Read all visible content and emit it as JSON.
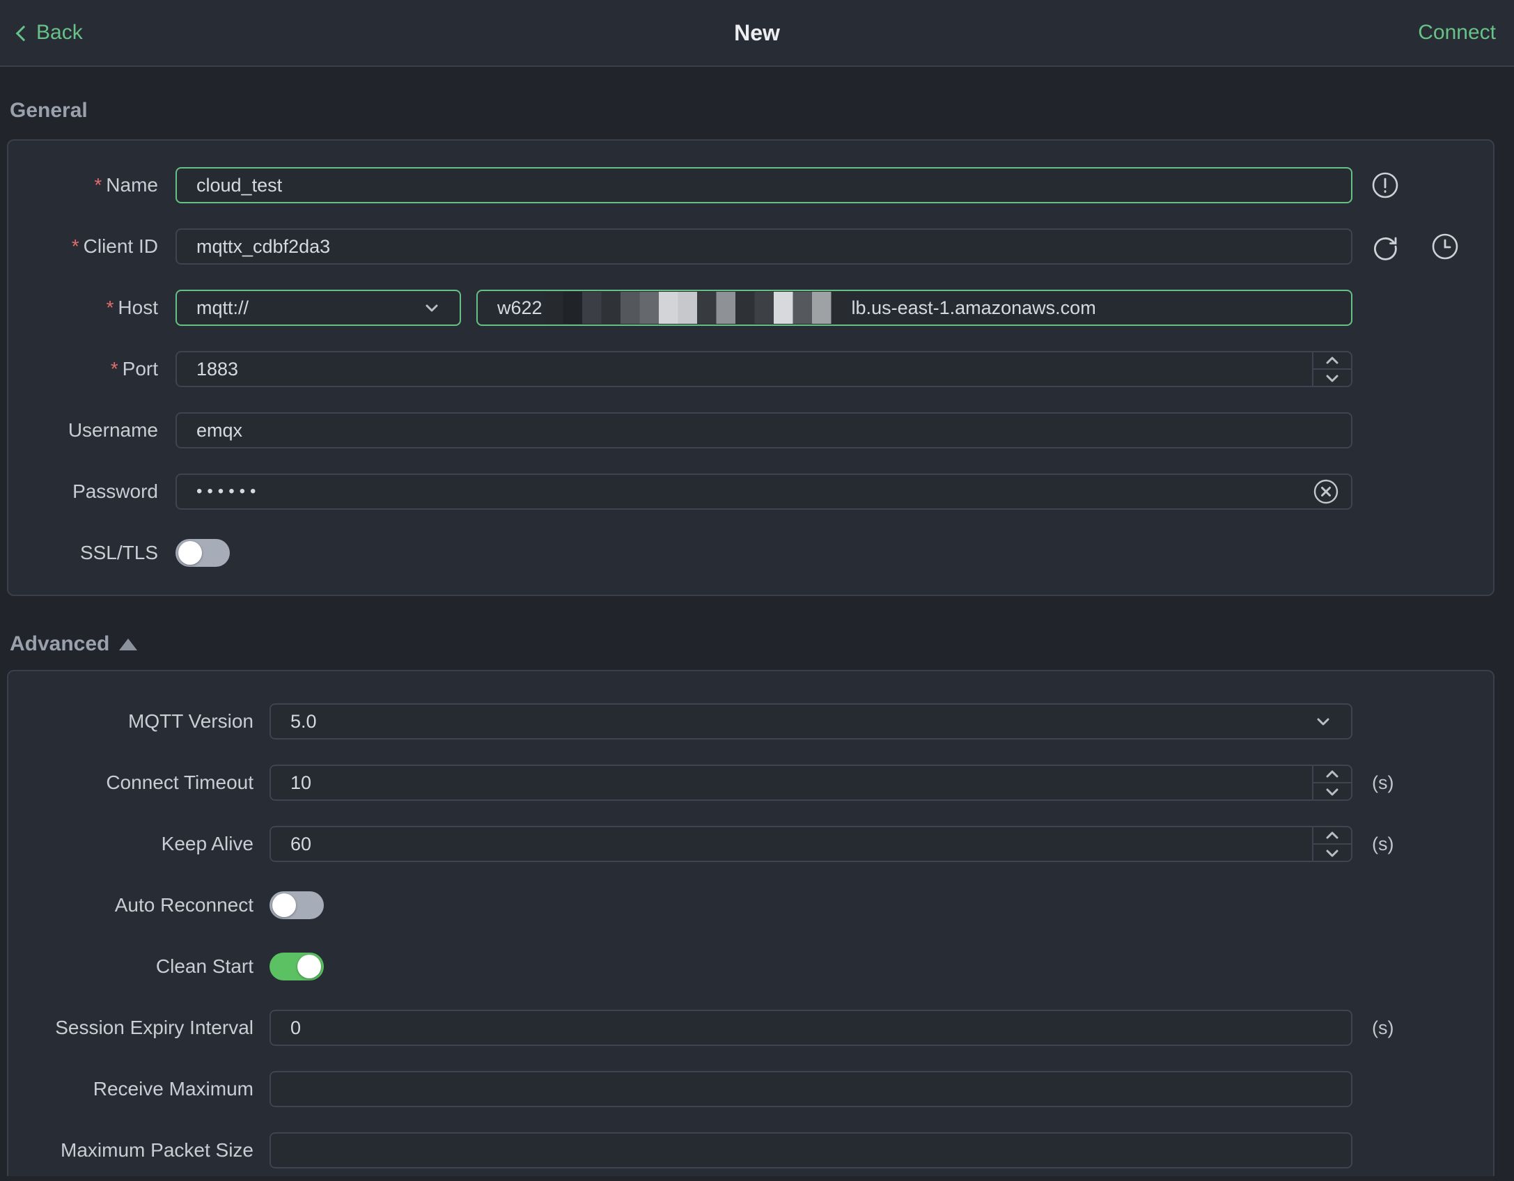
{
  "topbar": {
    "back_label": "Back",
    "title": "New",
    "connect_label": "Connect"
  },
  "required_marker": "*",
  "general": {
    "heading": "General",
    "name": {
      "label": "Name",
      "value": "cloud_test"
    },
    "client_id": {
      "label": "Client ID",
      "value": "mqttx_cdbf2da3"
    },
    "host": {
      "label": "Host",
      "protocol": "mqtt://",
      "visible_prefix": "w622",
      "redacted": true,
      "visible_suffix": "lb.us-east-1.amazonaws.com"
    },
    "port": {
      "label": "Port",
      "value": "1883"
    },
    "username": {
      "label": "Username",
      "value": "emqx"
    },
    "password": {
      "label": "Password",
      "value": "••••••"
    },
    "ssl": {
      "label": "SSL/TLS",
      "enabled": false
    }
  },
  "advanced": {
    "heading": "Advanced",
    "mqtt_version": {
      "label": "MQTT Version",
      "value": "5.0"
    },
    "connect_timeout": {
      "label": "Connect Timeout",
      "value": "10",
      "unit": "(s)"
    },
    "keep_alive": {
      "label": "Keep Alive",
      "value": "60",
      "unit": "(s)"
    },
    "auto_reconnect": {
      "label": "Auto Reconnect",
      "enabled": false
    },
    "clean_start": {
      "label": "Clean Start",
      "enabled": true
    },
    "session_expiry": {
      "label": "Session Expiry Interval",
      "value": "0",
      "unit": "(s)"
    },
    "receive_maximum": {
      "label": "Receive Maximum",
      "value": ""
    },
    "maximum_packet_size": {
      "label": "Maximum Packet Size",
      "value": ""
    }
  },
  "colors": {
    "accent_green": "#66c185",
    "toggle_on_green": "#5bc162",
    "required_red": "#e06c6c"
  },
  "icons": [
    "back-chevron-icon",
    "warning-circle-icon",
    "refresh-icon",
    "history-clock-icon",
    "clear-circle-icon",
    "chevron-down-icon",
    "spinner-up-icon",
    "spinner-down-icon",
    "collapse-triangle-icon"
  ]
}
